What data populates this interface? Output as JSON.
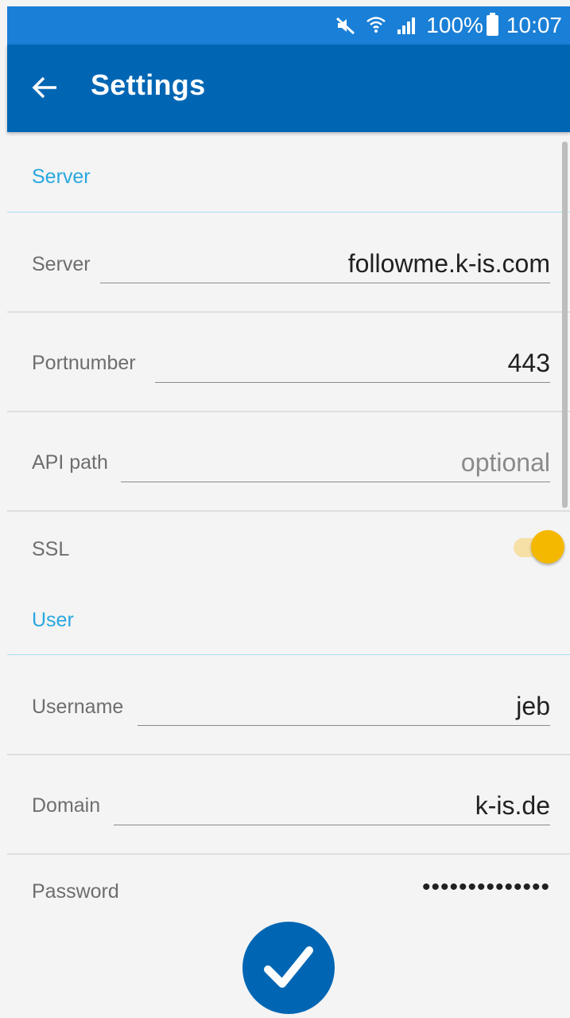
{
  "status_bar": {
    "battery_percent": "100%",
    "time": "10:07",
    "icons": [
      "mute-icon",
      "wifi-icon",
      "signal-icon",
      "battery-icon"
    ]
  },
  "app_bar": {
    "title": "Settings",
    "back_icon": "arrow-left-icon"
  },
  "sections": {
    "server": {
      "header": "Server",
      "server_label": "Server",
      "server_value": "followme.k-is.com",
      "port_label": "Portnumber",
      "port_value": "443",
      "api_label": "API path",
      "api_placeholder": "optional",
      "ssl_label": "SSL",
      "ssl_enabled": true
    },
    "user": {
      "header": "User",
      "username_label": "Username",
      "username_value": "jeb",
      "domain_label": "Domain",
      "domain_value": "k-is.de",
      "password_label": "Password",
      "password_value": "••••••••••••••"
    }
  },
  "colors": {
    "status_bar": "#1a7fd6",
    "app_bar": "#0066b3",
    "section_header": "#29a7e0",
    "toggle_thumb": "#f5b800",
    "toggle_track": "#f7e0a6",
    "background": "#f4f4f4"
  },
  "submit_icon": "checkmark-icon"
}
